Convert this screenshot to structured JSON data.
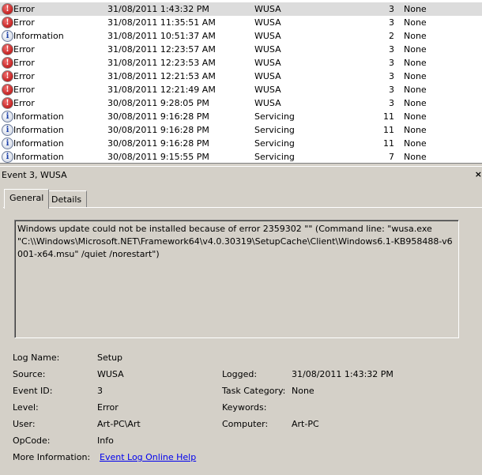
{
  "events": [
    {
      "level": "Error",
      "icon": "error-icon",
      "date": "31/08/2011 1:43:32 PM",
      "source": "WUSA",
      "id": "3",
      "task": "None",
      "selected": true
    },
    {
      "level": "Error",
      "icon": "error-icon",
      "date": "31/08/2011 11:35:51 AM",
      "source": "WUSA",
      "id": "3",
      "task": "None"
    },
    {
      "level": "Information",
      "icon": "info-icon",
      "date": "31/08/2011 10:51:37 AM",
      "source": "WUSA",
      "id": "2",
      "task": "None"
    },
    {
      "level": "Error",
      "icon": "error-icon",
      "date": "31/08/2011 12:23:57 AM",
      "source": "WUSA",
      "id": "3",
      "task": "None"
    },
    {
      "level": "Error",
      "icon": "error-icon",
      "date": "31/08/2011 12:23:53 AM",
      "source": "WUSA",
      "id": "3",
      "task": "None"
    },
    {
      "level": "Error",
      "icon": "error-icon",
      "date": "31/08/2011 12:21:53 AM",
      "source": "WUSA",
      "id": "3",
      "task": "None"
    },
    {
      "level": "Error",
      "icon": "error-icon",
      "date": "31/08/2011 12:21:49 AM",
      "source": "WUSA",
      "id": "3",
      "task": "None"
    },
    {
      "level": "Error",
      "icon": "error-icon",
      "date": "30/08/2011 9:28:05 PM",
      "source": "WUSA",
      "id": "3",
      "task": "None"
    },
    {
      "level": "Information",
      "icon": "info-icon",
      "date": "30/08/2011 9:16:28 PM",
      "source": "Servicing",
      "id": "11",
      "task": "None"
    },
    {
      "level": "Information",
      "icon": "info-icon",
      "date": "30/08/2011 9:16:28 PM",
      "source": "Servicing",
      "id": "11",
      "task": "None"
    },
    {
      "level": "Information",
      "icon": "info-icon",
      "date": "30/08/2011 9:16:28 PM",
      "source": "Servicing",
      "id": "11",
      "task": "None"
    },
    {
      "level": "Information",
      "icon": "info-icon",
      "date": "30/08/2011 9:15:55 PM",
      "source": "Servicing",
      "id": "7",
      "task": "None"
    }
  ],
  "detail": {
    "title": "Event 3, WUSA",
    "close": "×",
    "tabs": [
      "General",
      "Details"
    ],
    "description": "Windows update  could not be installed because of error 2359302 \"\" (Command line: \"wusa.exe \"C:\\\\Windows\\Microsoft.NET\\Framework64\\v4.0.30319\\SetupCache\\Client\\Windows6.1-KB958488-v6001-x64.msu\" /quiet /norestart\")",
    "fields": {
      "log_name_label": "Log Name:",
      "log_name": "Setup",
      "source_label": "Source:",
      "source": "WUSA",
      "logged_label": "Logged:",
      "logged": "31/08/2011 1:43:32 PM",
      "event_id_label": "Event ID:",
      "event_id": "3",
      "task_category_label": "Task Category:",
      "task_category": "None",
      "level_label": "Level:",
      "level": "Error",
      "keywords_label": "Keywords:",
      "user_label": "User:",
      "user": "Art-PC\\Art",
      "computer_label": "Computer:",
      "computer": "Art-PC",
      "opcode_label": "OpCode:",
      "opcode": "Info",
      "more_info_label": "More Information:",
      "more_info_link": "Event Log Online Help"
    }
  }
}
